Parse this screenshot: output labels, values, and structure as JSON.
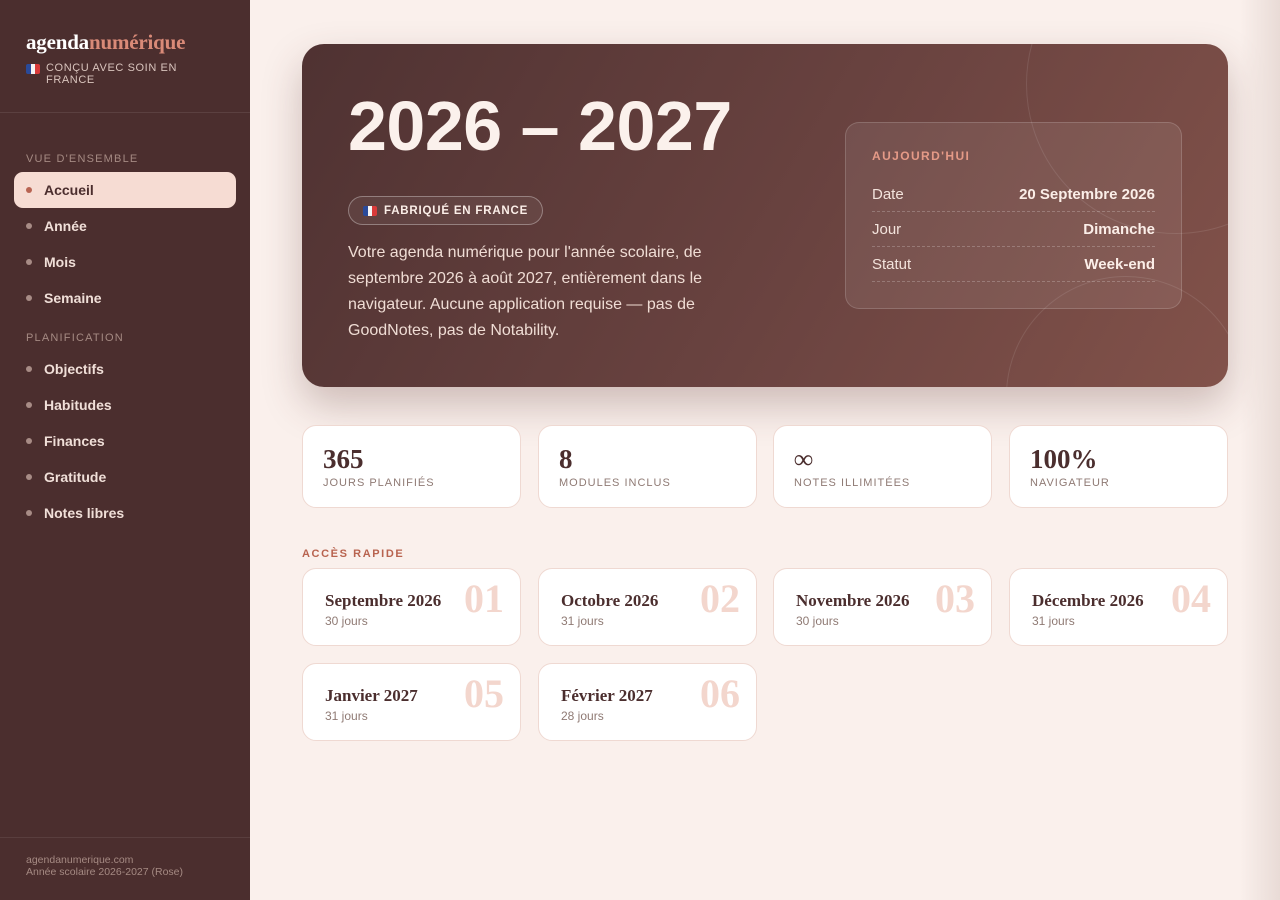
{
  "sidebar": {
    "brand_part1": "agenda",
    "brand_part2": "numérique",
    "tagline": "CONÇU AVEC SOIN EN FRANCE",
    "section_overview": "VUE D'ENSEMBLE",
    "section_planning": "PLANIFICATION",
    "overview_items": [
      {
        "label": "Accueil",
        "active": true
      },
      {
        "label": "Année"
      },
      {
        "label": "Mois"
      },
      {
        "label": "Semaine"
      }
    ],
    "planning_items": [
      {
        "label": "Objectifs"
      },
      {
        "label": "Habitudes"
      },
      {
        "label": "Finances"
      },
      {
        "label": "Gratitude"
      },
      {
        "label": "Notes libres"
      }
    ],
    "footer_site": "agendanumerique.com",
    "footer_edition": "Année scolaire 2026-2027 (Rose)"
  },
  "hero": {
    "title": "2026 – 2027",
    "badge": "FABRIQUÉ EN FRANCE",
    "description": "Votre agenda numérique pour l'année scolaire, de septembre 2026 à août 2027, entièrement dans le navigateur. Aucune application requise — pas de GoodNotes, pas de Notability.",
    "today": {
      "label": "AUJOURD'HUI",
      "rows": [
        {
          "key": "Date",
          "value": "20 Septembre 2026"
        },
        {
          "key": "Jour",
          "value": "Dimanche"
        },
        {
          "key": "Statut",
          "value": "Week-end"
        }
      ]
    }
  },
  "stats": [
    {
      "value": "365",
      "label": "JOURS PLANIFIÉS"
    },
    {
      "value": "8",
      "label": "MODULES INCLUS"
    },
    {
      "value": "∞",
      "label": "NOTES ILLIMITÉES"
    },
    {
      "value": "100%",
      "label": "NAVIGATEUR"
    }
  ],
  "quick_access": {
    "title": "ACCÈS RAPIDE",
    "months": [
      {
        "name": "Septembre 2026",
        "days": "30 jours",
        "num": "01"
      },
      {
        "name": "Octobre 2026",
        "days": "31 jours",
        "num": "02"
      },
      {
        "name": "Novembre 2026",
        "days": "30 jours",
        "num": "03"
      },
      {
        "name": "Décembre 2026",
        "days": "31 jours",
        "num": "04"
      },
      {
        "name": "Janvier 2027",
        "days": "31 jours",
        "num": "05"
      },
      {
        "name": "Février 2027",
        "days": "28 jours",
        "num": "06"
      }
    ]
  },
  "colors": {
    "sidebar_bg": "#4b2e2e",
    "accent": "#d98a78",
    "active_item_bg": "#f6dcd3",
    "page_bg": "#faf0ec"
  }
}
